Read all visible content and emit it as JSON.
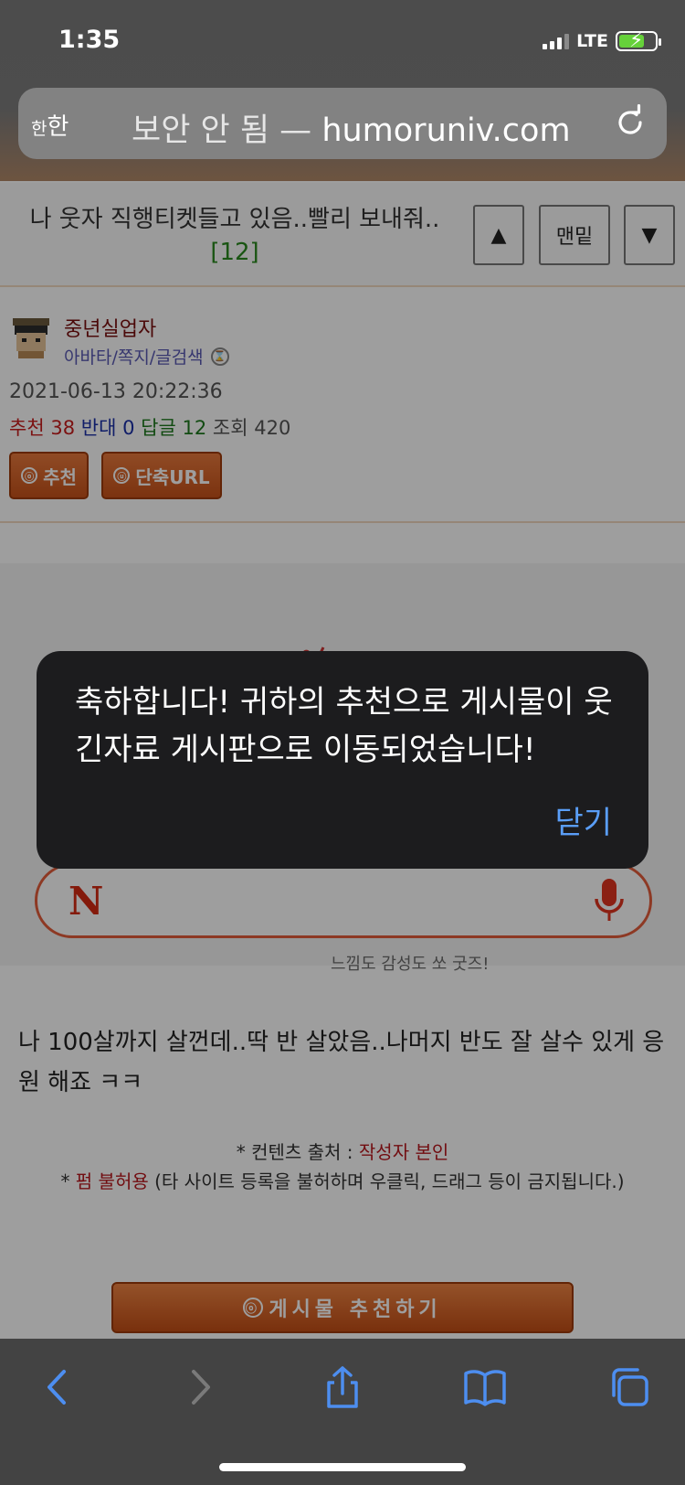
{
  "status_bar": {
    "time": "1:35",
    "network": "LTE"
  },
  "browser": {
    "aa_label": "한",
    "aa_label_small": "한",
    "url_prefix": "보안 안 됨 — ",
    "url_domain": "humoruniv.com"
  },
  "post": {
    "title": "나 웃자 직행티켓들고 있음..빨리 보내줘..",
    "comment_count": "[12]",
    "nav": {
      "up": "▲",
      "bottom": "맨밑",
      "down": "▼"
    },
    "author": {
      "name": "중년실업자",
      "links": "아바타/쪽지/글검색"
    },
    "date": "2021-06-13 20:22:36",
    "stats": {
      "rec_label": "추천",
      "rec_value": "38",
      "opp_label": "반대",
      "opp_value": "0",
      "reply_label": "답글",
      "reply_value": "12",
      "view_label": "조회",
      "view_value": "420"
    },
    "buttons": {
      "recommend": "추천",
      "short_url": "단축URL",
      "rec_circle": "ⓞ",
      "url_circle": "ⓤ"
    },
    "ad": {
      "caption": "느낌도 감성도 쏘 굿즈!"
    },
    "body": "나 100살까지 살껀데..딱 반 살았음..나머지 반도 잘 살수 있게 응원 해죠 ㅋㅋ",
    "source": {
      "prefix": "* 컨텐츠 출처 : ",
      "value": "작성자 본인"
    },
    "copyright": {
      "prefix": "* ",
      "red": "펌 불허용",
      "rest": " (타 사이트 등록을 불허하며 우클릭, 드래그 등이 금지됩니다.)"
    },
    "big_recommend": "게시물  추천하기"
  },
  "alert": {
    "message": "축하합니다! 귀하의 추천으로 게시물이 웃긴자료 게시판으로 이동되었습니다!",
    "close": "닫기"
  },
  "toolbar": {
    "icons": [
      "back-icon",
      "forward-icon",
      "share-icon",
      "bookmarks-icon",
      "tabs-icon"
    ]
  }
}
